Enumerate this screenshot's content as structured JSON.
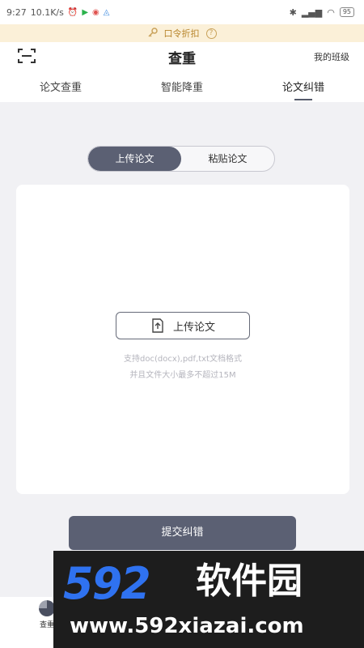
{
  "status_bar": {
    "time": "9:27",
    "network": "10.1K/s",
    "battery": "95"
  },
  "promo": {
    "text": "口令折扣",
    "help": "?"
  },
  "header": {
    "title": "查重",
    "my_class": "我的班级"
  },
  "tabs": [
    {
      "label": "论文查重",
      "active": false
    },
    {
      "label": "智能降重",
      "active": false
    },
    {
      "label": "论文纠错",
      "active": true
    }
  ],
  "segment": {
    "upload": "上传论文",
    "paste": "粘贴论文"
  },
  "upload_card": {
    "button_label": "上传论文",
    "hint_line1": "支持doc(docx),pdf,txt文档格式",
    "hint_line2": "并且文件大小最多不超过15M"
  },
  "submit": {
    "label": "提交纠错"
  },
  "bottom_nav": {
    "label": "查重"
  },
  "watermark": {
    "logo": "592",
    "brand": "软件园",
    "url": "www.592xiazai.com"
  },
  "colors": {
    "accent": "#5b6073",
    "promo_bg": "#fbf0d8",
    "promo_text": "#b8862c",
    "watermark_blue": "#2f72f0"
  }
}
